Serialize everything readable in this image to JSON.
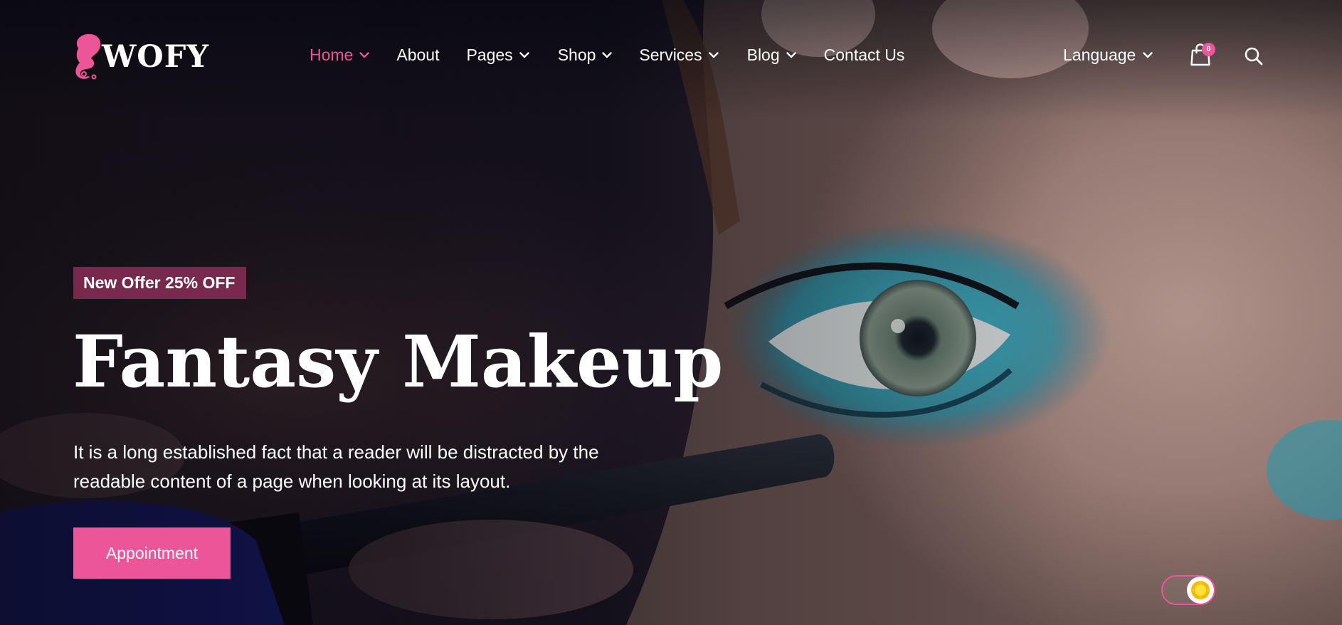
{
  "brand": {
    "name": "WOFY",
    "accent_color": "#ec5598",
    "logo_icon": "woman-silhouette-logo"
  },
  "nav": {
    "items": [
      {
        "label": "Home",
        "active": true,
        "has_dropdown": true
      },
      {
        "label": "About",
        "active": false,
        "has_dropdown": false
      },
      {
        "label": "Pages",
        "active": false,
        "has_dropdown": true
      },
      {
        "label": "Shop",
        "active": false,
        "has_dropdown": true
      },
      {
        "label": "Services",
        "active": false,
        "has_dropdown": true
      },
      {
        "label": "Blog",
        "active": false,
        "has_dropdown": true
      },
      {
        "label": "Contact Us",
        "active": false,
        "has_dropdown": false
      }
    ],
    "language_label": "Language",
    "cart_count": "0",
    "cart_icon": "shopping-bag-icon",
    "search_icon": "search-icon"
  },
  "hero": {
    "badge": "New Offer 25% OFF",
    "title": "Fantasy Makeup",
    "description": "It is a long established fact that a reader will be distracted by the readable content of a page when looking at its layout.",
    "button_label": "Appointment",
    "background": "close-up of eye with teal eyeshadow and mascara wand"
  },
  "theme_toggle": {
    "state": "light",
    "icon": "sun-icon"
  }
}
